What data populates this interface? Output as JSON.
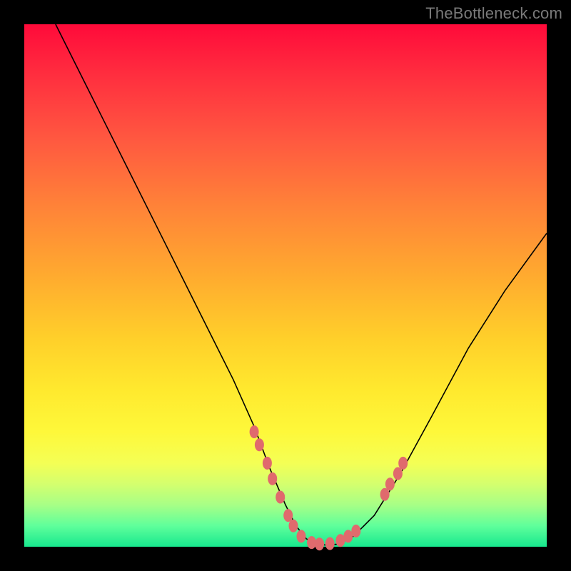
{
  "watermark": "TheBottleneck.com",
  "colors": {
    "background": "#000000",
    "gradient_top": "#ff0a3a",
    "gradient_bottom": "#17e88e",
    "curve": "#000000",
    "dots": "#e06a6d"
  },
  "chart_data": {
    "type": "line",
    "title": "",
    "xlabel": "",
    "ylabel": "",
    "xlim": [
      0,
      100
    ],
    "ylim": [
      0,
      100
    ],
    "series": [
      {
        "name": "curve",
        "x": [
          6,
          10,
          15,
          20,
          25,
          30,
          35,
          40,
          44,
          47,
          50,
          52,
          54,
          56,
          58,
          60,
          63,
          67,
          72,
          78,
          85,
          92,
          100
        ],
        "y": [
          100,
          92,
          82,
          72,
          62,
          52,
          42,
          32,
          23,
          15,
          8,
          4,
          1.5,
          0.5,
          0.3,
          0.5,
          2,
          6,
          14,
          25,
          38,
          49,
          60
        ]
      }
    ],
    "dots": [
      {
        "x": 44.0,
        "y": 22.0
      },
      {
        "x": 45.0,
        "y": 19.5
      },
      {
        "x": 46.5,
        "y": 16.0
      },
      {
        "x": 47.5,
        "y": 13.0
      },
      {
        "x": 49.0,
        "y": 9.5
      },
      {
        "x": 50.5,
        "y": 6.0
      },
      {
        "x": 51.5,
        "y": 4.0
      },
      {
        "x": 53.0,
        "y": 2.0
      },
      {
        "x": 55.0,
        "y": 0.8
      },
      {
        "x": 56.5,
        "y": 0.5
      },
      {
        "x": 58.5,
        "y": 0.6
      },
      {
        "x": 60.5,
        "y": 1.2
      },
      {
        "x": 62.0,
        "y": 2.0
      },
      {
        "x": 63.5,
        "y": 3.0
      },
      {
        "x": 69.0,
        "y": 10.0
      },
      {
        "x": 70.0,
        "y": 12.0
      },
      {
        "x": 71.5,
        "y": 14.0
      },
      {
        "x": 72.5,
        "y": 16.0
      }
    ]
  }
}
